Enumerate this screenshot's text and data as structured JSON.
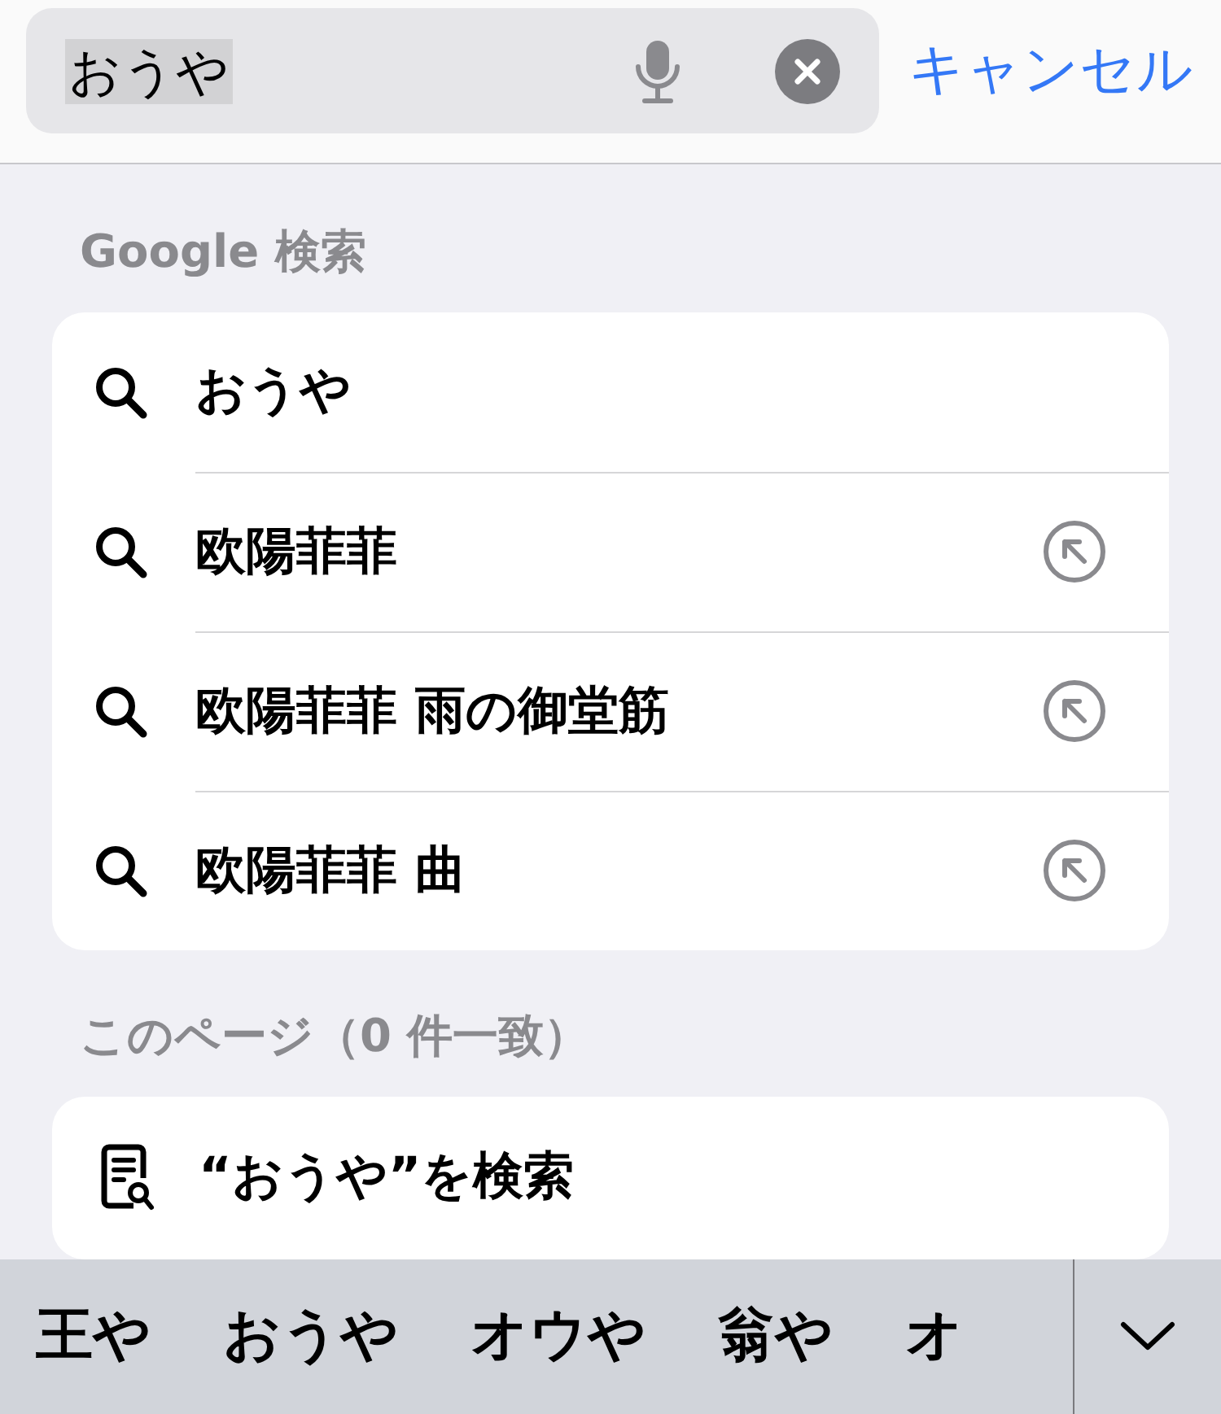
{
  "search": {
    "value": "おうや",
    "cancel": "キャンセル"
  },
  "google_section": {
    "title": "Google 検索",
    "suggestions": [
      {
        "text": "おうや",
        "fill_in": false
      },
      {
        "text": "欧陽菲菲",
        "fill_in": true
      },
      {
        "text": "欧陽菲菲 雨の御堂筋",
        "fill_in": true
      },
      {
        "text": "欧陽菲菲 曲",
        "fill_in": true
      }
    ]
  },
  "page_section": {
    "title": "このページ（0 件一致）",
    "find_label": "“おうや”を検索"
  },
  "candidates": [
    "王や",
    "おうや",
    "オウや",
    "翁や",
    "オ"
  ]
}
